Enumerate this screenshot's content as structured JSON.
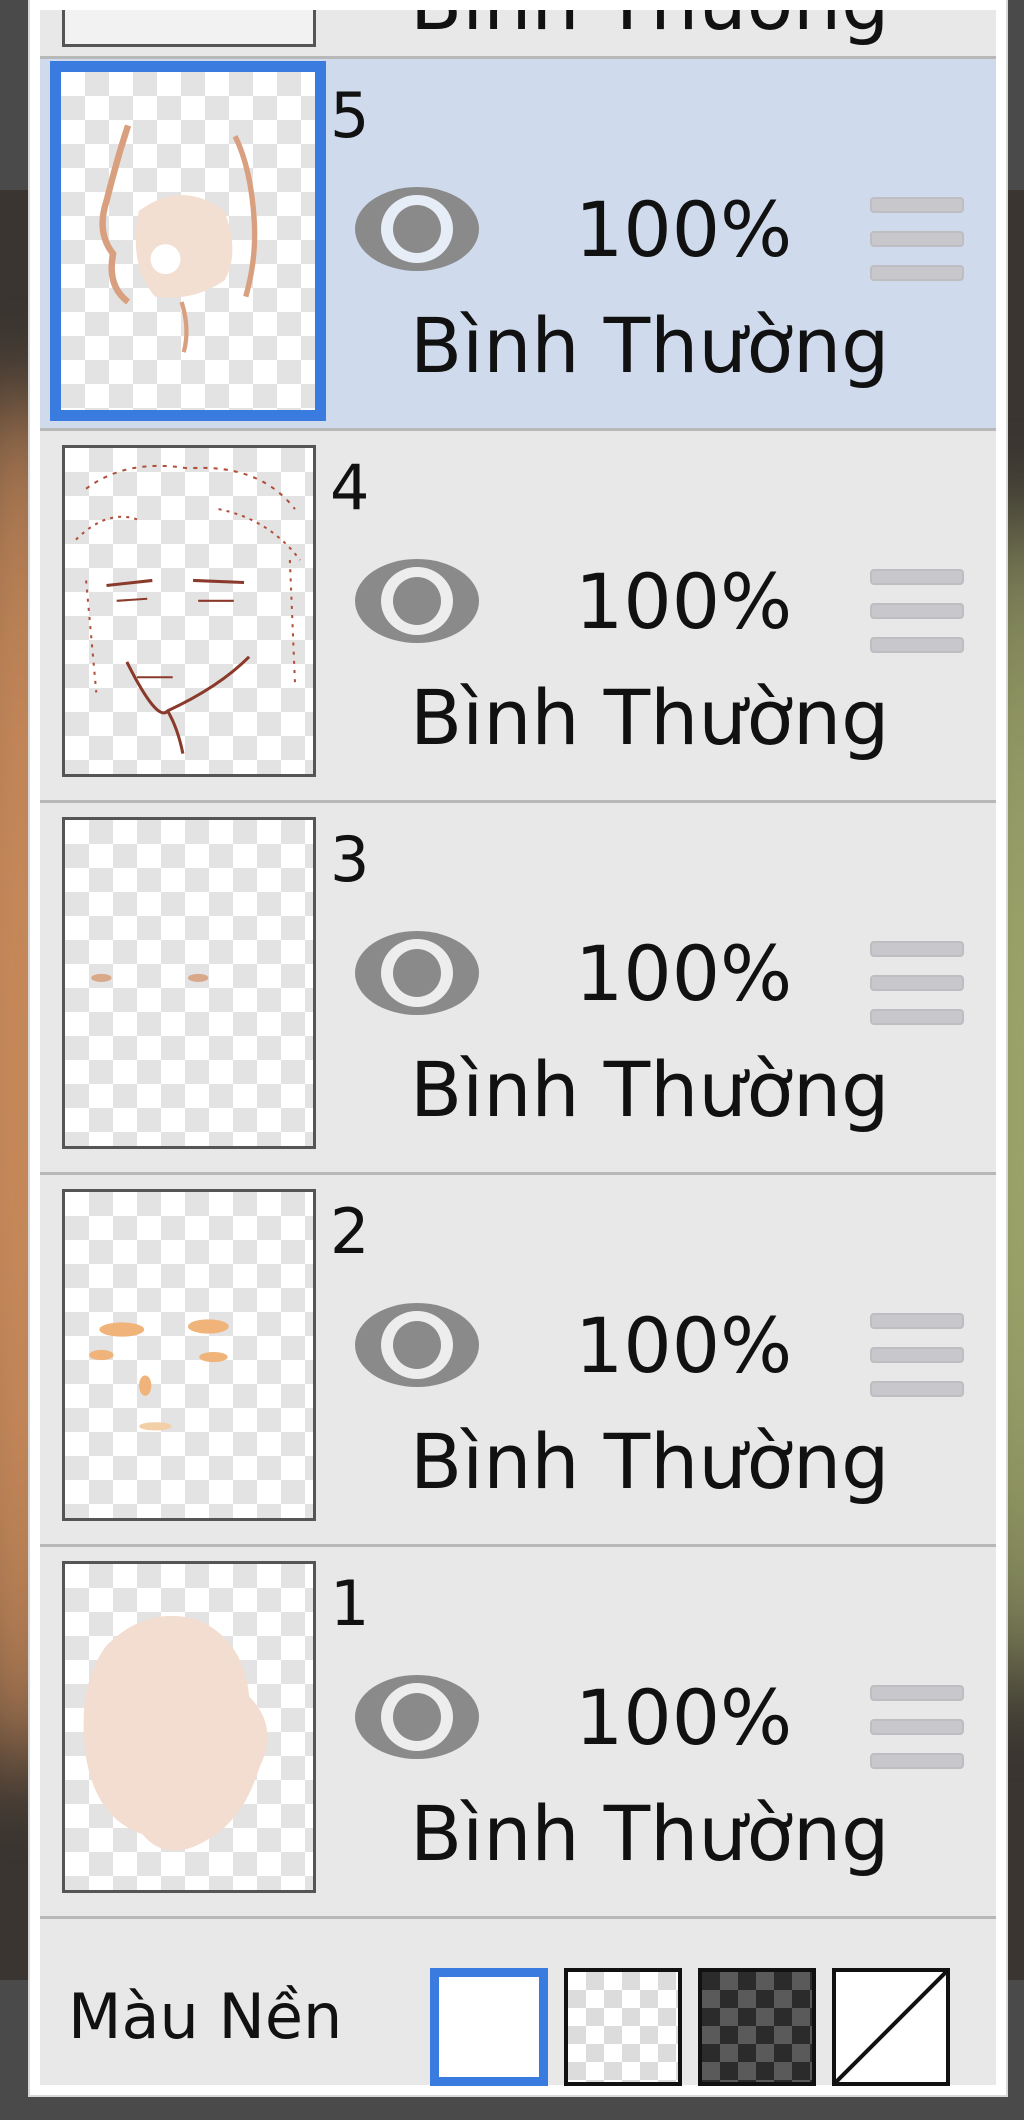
{
  "layers": [
    {
      "number": "5",
      "opacity": "100%",
      "blend_mode": "Bình Thường",
      "selected": true,
      "visible": true
    },
    {
      "number": "4",
      "opacity": "100%",
      "blend_mode": "Bình Thường",
      "selected": false,
      "visible": true
    },
    {
      "number": "3",
      "opacity": "100%",
      "blend_mode": "Bình Thường",
      "selected": false,
      "visible": true
    },
    {
      "number": "2",
      "opacity": "100%",
      "blend_mode": "Bình Thường",
      "selected": false,
      "visible": true
    },
    {
      "number": "1",
      "opacity": "100%",
      "blend_mode": "Bình Thường",
      "selected": false,
      "visible": true
    }
  ],
  "top_partial": {
    "blend_mode": "Bình Thường"
  },
  "footer": {
    "label": "Màu Nền",
    "options": [
      "white",
      "transparent-light",
      "transparent-dark",
      "none"
    ],
    "selected": "white"
  },
  "colors": {
    "accent": "#3a7be0",
    "selected_row": "#cfdbec",
    "row": "#e8e8e8",
    "eye_icon": "#8a8a8a"
  }
}
